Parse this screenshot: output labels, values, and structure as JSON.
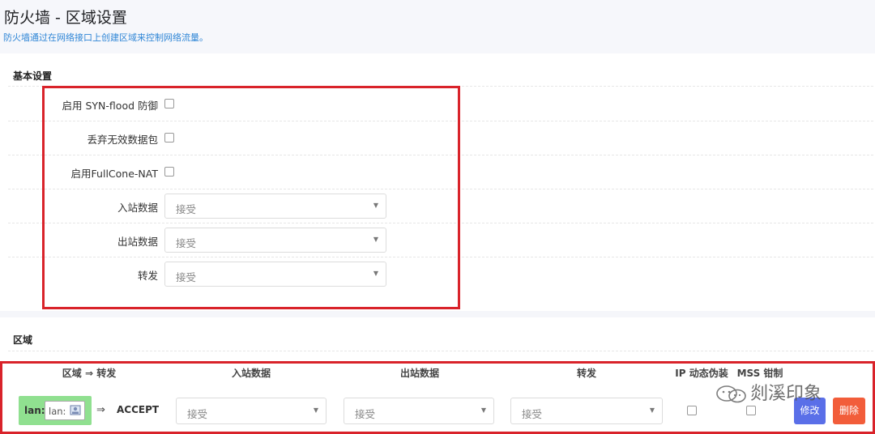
{
  "header": {
    "title": "防火墙 - 区域设置",
    "description": "防火墙通过在网络接口上创建区域来控制网络流量。"
  },
  "basic": {
    "section_title": "基本设置",
    "syn_flood": {
      "label": "启用 SYN-flood 防御",
      "checked": false
    },
    "drop_invalid": {
      "label": "丢弃无效数据包",
      "checked": false
    },
    "fullcone": {
      "label": "启用FullCone-NAT",
      "checked": false
    },
    "input": {
      "label": "入站数据",
      "value": "接受"
    },
    "output": {
      "label": "出站数据",
      "value": "接受"
    },
    "forward": {
      "label": "转发",
      "value": "接受"
    }
  },
  "zones": {
    "section_title": "区域",
    "columns": {
      "zone_forward": "区域 ⇒ 转发",
      "input": "入站数据",
      "output": "出站数据",
      "forward": "转发",
      "masq": "IP 动态伪装",
      "mss": "MSS 钳制"
    },
    "rows": [
      {
        "zone_name": "lan:",
        "network": "lan:",
        "arrow": "⇒",
        "forward_target": "ACCEPT",
        "input": "接受",
        "output": "接受",
        "forward": "接受",
        "masq": false,
        "mss": false,
        "edit_label": "修改",
        "delete_label": "删除"
      }
    ]
  },
  "watermark": "剡溪印象",
  "colors": {
    "accent_link": "#2f86d6",
    "zone_lan": "#90e090",
    "edit_button": "#5a6fe8",
    "delete_button": "#f25d3a",
    "highlight_box": "#d9232a"
  }
}
